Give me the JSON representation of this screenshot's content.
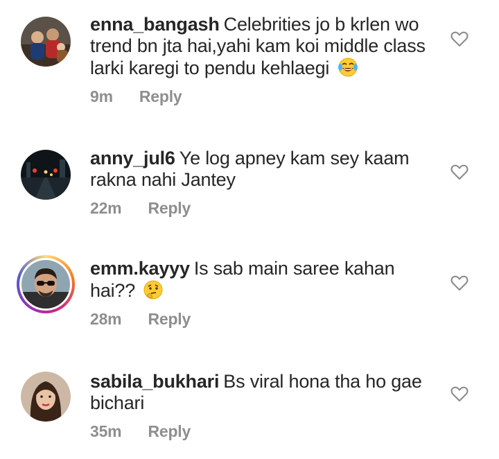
{
  "comments": [
    {
      "username": "enna_bangash",
      "text": "Celebrities jo b krlen wo trend bn jta hai,yahi kam koi middle class larki karegi to pendu kehlaegi",
      "emoji": "laughing-tears",
      "time": "9m",
      "reply": "Reply"
    },
    {
      "username": "anny_jul6",
      "text": "Ye log apney kam sey kaam rakna nahi Jantey",
      "time": "22m",
      "reply": "Reply"
    },
    {
      "username": "emm.kayyy",
      "text": "Is sab main saree kahan hai??",
      "emoji": "thinking-face",
      "time": "28m",
      "reply": "Reply"
    },
    {
      "username": "sabila_bukhari",
      "text": "Bs viral hona tha ho gae bichari",
      "time": "35m",
      "reply": "Reply"
    }
  ],
  "colors": {
    "text": "#262626",
    "meta": "#8e8e8e",
    "heart_outline": "#8e8e8e"
  }
}
